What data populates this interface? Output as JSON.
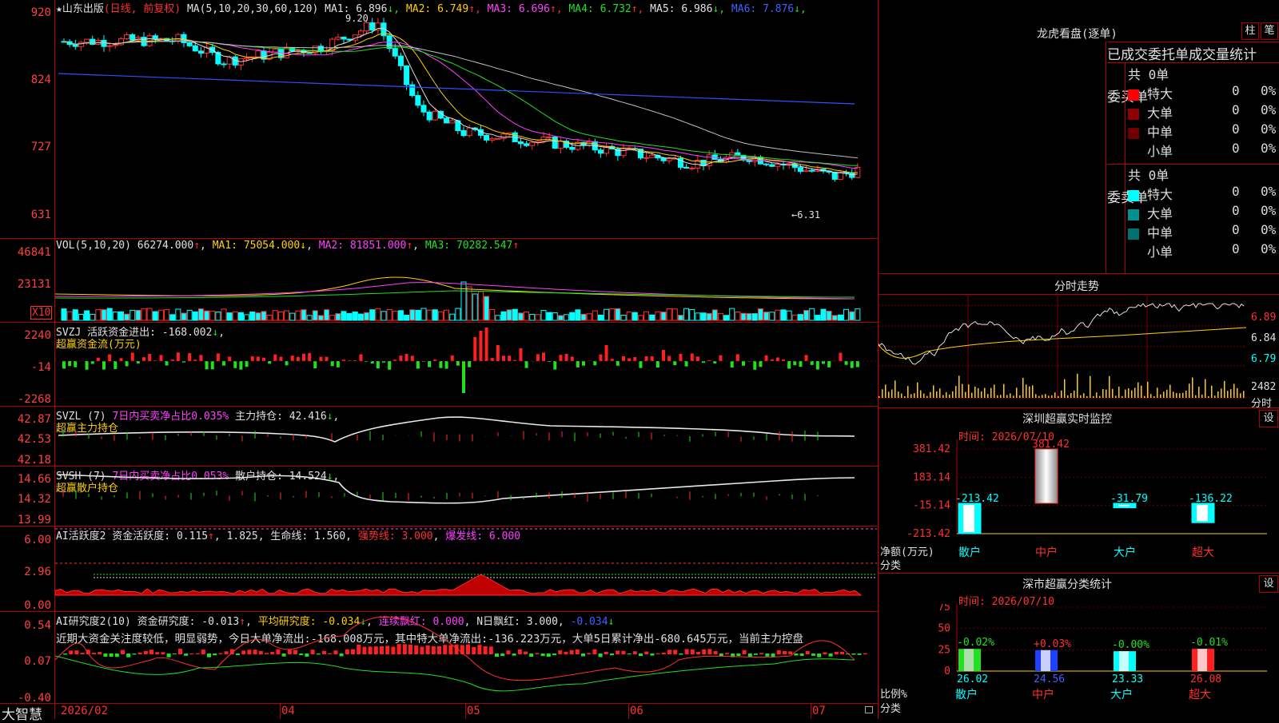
{
  "stock": {
    "name": "★山东出版",
    "mode": "(日线, 前复权)",
    "ma_params": "MA(5,10,20,30,60,120)",
    "ma_values": [
      {
        "label": "MA1: 6.896",
        "arrow": "↓",
        "color": "#e0e0e0"
      },
      {
        "label": "MA2: 6.749",
        "arrow": "↑",
        "color": "#ffd000"
      },
      {
        "label": "MA3: 6.696",
        "arrow": "↑",
        "color": "#ff40ff"
      },
      {
        "label": "MA4: 6.732",
        "arrow": "↑",
        "color": "#20e020"
      },
      {
        "label": "MA5: 6.986",
        "arrow": "↓",
        "color": "#e0e0e0"
      },
      {
        "label": "MA6: 7.876",
        "arrow": "↓",
        "color": "#4060ff"
      }
    ],
    "price_axis": [
      "920",
      "824",
      "727",
      "631"
    ],
    "high_marker": "9.20",
    "low_marker": "←6.31"
  },
  "vol": {
    "title": "VOL(5,10,20)",
    "value": "66274.000",
    "ma1": "MA1: 75054.000",
    "ma2": "MA2: 81851.000",
    "ma3": "MA3: 70282.547",
    "axis": [
      "46841",
      "23131"
    ],
    "unit": "X10"
  },
  "svzj": {
    "title": "SVZJ  活跃资金进出: -168.002",
    "subtitle": "超赢资金流(万元)",
    "axis": [
      "2240",
      "-14",
      "-2268"
    ]
  },
  "svzl": {
    "title": "SVZL (7)",
    "part1": "7日内买卖净占比0.035%",
    "part2": "主力持仓: 42.416",
    "subtitle": "超赢主力持仓",
    "axis": [
      "42.87",
      "42.53",
      "42.18"
    ]
  },
  "svsh": {
    "title": "SVSH (7)",
    "part1": "7日内买卖净占比0.053%",
    "part2": "散户持仓: 14.524",
    "subtitle": "超赢散户持仓",
    "axis": [
      "14.66",
      "14.32",
      "13.99"
    ]
  },
  "ai1": {
    "title": "AI活跃度2 资金活跃度: 0.115",
    "v2": "1.825",
    "v3": "生命线: 1.560",
    "v4": "强势线: 3.000",
    "v5": "爆发线: 6.000",
    "axis": [
      "6.00",
      "2.96",
      "0.00"
    ]
  },
  "ai2": {
    "title": "AI研究度2(10) 资金研究度: -0.013",
    "v2": "平均研究度: -0.034",
    "v3": "连续飘红: 0.000",
    "v4": "N日飘红: 3.000",
    "v5": "-0.034",
    "text": "近期大资金关注度较低，明显弱势，今日大单净流出:-168.008万元，其中特大单净流出:-136.223万元，大单5日累计净出-680.645万元，当前主力控盘",
    "axis": [
      "0.54",
      "0.07",
      "-0.40"
    ]
  },
  "bottom": {
    "brand": "大智慧",
    "dates": [
      "2026/02",
      "04",
      "05",
      "06",
      "07"
    ]
  },
  "longhu": {
    "title": "龙虎看盘(逐单)",
    "btn1": "柱",
    "btn2": "笔",
    "subtitle": "已成交委托单成交量统计",
    "buy_label": "委买单",
    "sell_label": "委卖单",
    "buy_total": "共 0单",
    "sell_total": "共 0单",
    "buy_rows": [
      {
        "name": "特大",
        "count": "0",
        "pct": "0%",
        "color": "#ff0000"
      },
      {
        "name": "大单",
        "count": "0",
        "pct": "0%",
        "color": "#900000"
      },
      {
        "name": "中单",
        "count": "0",
        "pct": "0%",
        "color": "#700000"
      },
      {
        "name": "小单",
        "count": "0",
        "pct": "0%",
        "color": "#000000"
      }
    ],
    "sell_rows": [
      {
        "name": "特大",
        "count": "0",
        "pct": "0%",
        "color": "#00ffff"
      },
      {
        "name": "大单",
        "count": "0",
        "pct": "0%",
        "color": "#009090"
      },
      {
        "name": "中单",
        "count": "0",
        "pct": "0%",
        "color": "#007070"
      },
      {
        "name": "小单",
        "count": "0",
        "pct": "0%",
        "color": "#000000"
      }
    ]
  },
  "fenshi": {
    "title": "分时走势",
    "axis": [
      "6.89",
      "6.84",
      "6.79"
    ],
    "vol_axis": "2482",
    "vol_label": "分时"
  },
  "monitor": {
    "title": "深圳超赢实时监控",
    "btn": "设",
    "time": "时间: 2026/07/10",
    "axis": [
      "381.42",
      "183.14",
      "-15.14",
      "-213.42"
    ],
    "ylabel": "净额(万元)",
    "xlabel": "分类"
  },
  "classify": {
    "title": "深市超赢分类统计",
    "btn": "设",
    "time": "时间: 2026/07/10",
    "axis": [
      "75",
      "50",
      "25",
      "0"
    ],
    "ylabel": "比例%",
    "xlabel": "分类"
  },
  "chart_data": [
    {
      "type": "bar",
      "name": "net_amount",
      "categories": [
        "散户",
        "中户",
        "大户",
        "超大"
      ],
      "values": [
        -213.42,
        381.42,
        -31.79,
        -136.22
      ],
      "labels": [
        "-213.42",
        "381.42",
        "-31.79",
        "-136.22"
      ],
      "ylim": [
        -213.42,
        381.42
      ]
    },
    {
      "type": "bar",
      "name": "ratio",
      "categories": [
        "散户",
        "中户",
        "大户",
        "超大"
      ],
      "values": [
        26.02,
        24.56,
        23.33,
        26.08
      ],
      "labels": [
        "26.02",
        "24.56",
        "23.33",
        "26.08"
      ],
      "changes": [
        "-0.02%",
        "+0.03%",
        "-0.00%",
        "-0.01%"
      ],
      "colors": [
        "#20e020",
        "#2040ff",
        "#00ffff",
        "#ff2020"
      ],
      "ylim": [
        0,
        75
      ]
    }
  ]
}
